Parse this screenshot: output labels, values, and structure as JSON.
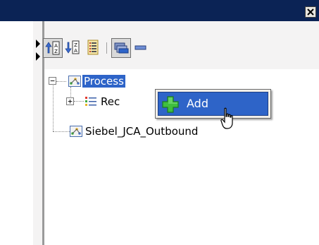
{
  "window": {
    "close_glyph": "✕"
  },
  "toolbar": {
    "buttons": [
      {
        "name": "sort-ascending-icon",
        "pressed": true
      },
      {
        "name": "sort-descending-icon",
        "pressed": false
      },
      {
        "name": "list-view-icon",
        "pressed": false
      },
      {
        "name": "tree-view-icon",
        "pressed": true
      },
      {
        "name": "collapse-icon",
        "pressed": false
      }
    ]
  },
  "tree": {
    "nodes": [
      {
        "label": "Process",
        "expanded": true,
        "selected": true,
        "icon": "process-icon"
      },
      {
        "label": "Rec",
        "expanded": false,
        "selected": false,
        "icon": "record-list-icon"
      },
      {
        "label": "Siebel_JCA_Outbound",
        "selected": false,
        "icon": "process-icon"
      }
    ]
  },
  "context_menu": {
    "items": [
      {
        "label": "Add",
        "icon": "add-icon",
        "highlighted": true
      }
    ]
  },
  "colors": {
    "titlebar": "#0b2355",
    "selection": "#2e64c8",
    "panel": "#f4f3f3"
  }
}
